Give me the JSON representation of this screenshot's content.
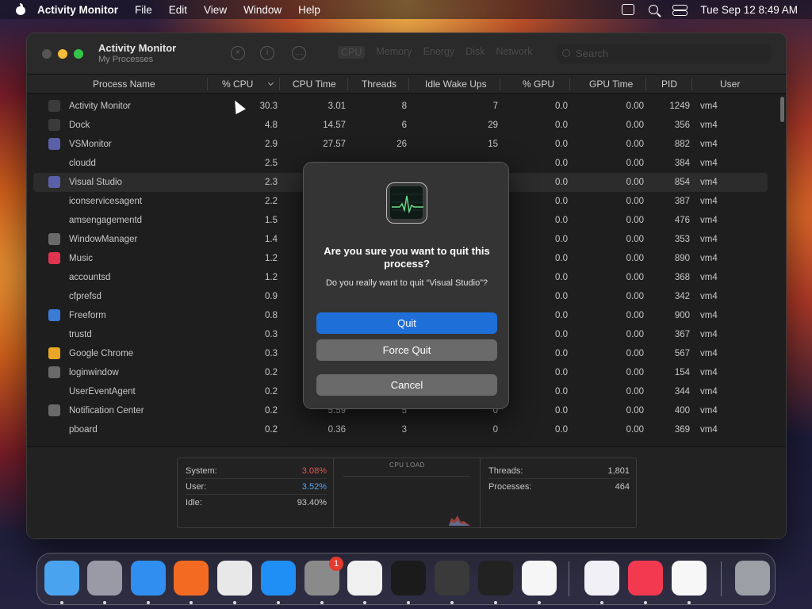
{
  "menubar": {
    "app_name": "Activity Monitor",
    "items": [
      "File",
      "Edit",
      "View",
      "Window",
      "Help"
    ],
    "datetime": "Tue Sep 12  8:49 AM"
  },
  "window": {
    "title": "Activity Monitor",
    "subtitle": "My Processes",
    "tabs": [
      "CPU",
      "Memory",
      "Energy",
      "Disk",
      "Network"
    ],
    "search_placeholder": "Search"
  },
  "table": {
    "columns": [
      "Process Name",
      "% CPU",
      "CPU Time",
      "Threads",
      "Idle Wake Ups",
      "% GPU",
      "GPU Time",
      "PID",
      "User"
    ],
    "rows": [
      {
        "name": "Activity Monitor",
        "cpu": "30.3",
        "cpu_time": "3.01",
        "threads": "8",
        "idle": "7",
        "gpu": "0.0",
        "gpu_time": "0.00",
        "pid": "1249",
        "user": "vm4",
        "icon": "activity-monitor-icon",
        "icon_color": "#3b3b3b"
      },
      {
        "name": "Dock",
        "cpu": "4.8",
        "cpu_time": "14.57",
        "threads": "6",
        "idle": "29",
        "gpu": "0.0",
        "gpu_time": "0.00",
        "pid": "356",
        "user": "vm4",
        "icon": "dock-icon",
        "icon_color": "#3b3b3b"
      },
      {
        "name": "VSMonitor",
        "cpu": "2.9",
        "cpu_time": "27.57",
        "threads": "26",
        "idle": "15",
        "gpu": "0.0",
        "gpu_time": "0.00",
        "pid": "882",
        "user": "vm4",
        "icon": "visual-studio-icon",
        "icon_color": "#5b5fa8"
      },
      {
        "name": "cloudd",
        "cpu": "2.5",
        "cpu_time": "",
        "threads": "",
        "idle": "",
        "gpu": "0.0",
        "gpu_time": "0.00",
        "pid": "384",
        "user": "vm4",
        "icon": "",
        "icon_color": ""
      },
      {
        "name": "Visual Studio",
        "cpu": "2.3",
        "cpu_time": "",
        "threads": "",
        "idle": "",
        "gpu": "0.0",
        "gpu_time": "0.00",
        "pid": "854",
        "user": "vm4",
        "icon": "visual-studio-icon",
        "icon_color": "#5b5fa8"
      },
      {
        "name": "iconservicesagent",
        "cpu": "2.2",
        "cpu_time": "",
        "threads": "",
        "idle": "",
        "gpu": "0.0",
        "gpu_time": "0.00",
        "pid": "387",
        "user": "vm4",
        "icon": "",
        "icon_color": ""
      },
      {
        "name": "amsengagementd",
        "cpu": "1.5",
        "cpu_time": "",
        "threads": "",
        "idle": "",
        "gpu": "0.0",
        "gpu_time": "0.00",
        "pid": "476",
        "user": "vm4",
        "icon": "",
        "icon_color": ""
      },
      {
        "name": "WindowManager",
        "cpu": "1.4",
        "cpu_time": "",
        "threads": "",
        "idle": "",
        "gpu": "0.0",
        "gpu_time": "0.00",
        "pid": "353",
        "user": "vm4",
        "icon": "window-manager-icon",
        "icon_color": "#6a6a6a"
      },
      {
        "name": "Music",
        "cpu": "1.2",
        "cpu_time": "",
        "threads": "",
        "idle": "",
        "gpu": "0.0",
        "gpu_time": "0.00",
        "pid": "890",
        "user": "vm4",
        "icon": "music-icon",
        "icon_color": "#e0344f"
      },
      {
        "name": "accountsd",
        "cpu": "1.2",
        "cpu_time": "",
        "threads": "",
        "idle": "",
        "gpu": "0.0",
        "gpu_time": "0.00",
        "pid": "368",
        "user": "vm4",
        "icon": "",
        "icon_color": ""
      },
      {
        "name": "cfprefsd",
        "cpu": "0.9",
        "cpu_time": "",
        "threads": "",
        "idle": "",
        "gpu": "0.0",
        "gpu_time": "0.00",
        "pid": "342",
        "user": "vm4",
        "icon": "",
        "icon_color": ""
      },
      {
        "name": "Freeform",
        "cpu": "0.8",
        "cpu_time": "",
        "threads": "",
        "idle": "",
        "gpu": "0.0",
        "gpu_time": "0.00",
        "pid": "900",
        "user": "vm4",
        "icon": "freeform-icon",
        "icon_color": "#3a7bd5"
      },
      {
        "name": "trustd",
        "cpu": "0.3",
        "cpu_time": "",
        "threads": "",
        "idle": "",
        "gpu": "0.0",
        "gpu_time": "0.00",
        "pid": "367",
        "user": "vm4",
        "icon": "",
        "icon_color": ""
      },
      {
        "name": "Google Chrome",
        "cpu": "0.3",
        "cpu_time": "",
        "threads": "",
        "idle": "",
        "gpu": "0.0",
        "gpu_time": "0.00",
        "pid": "567",
        "user": "vm4",
        "icon": "chrome-icon",
        "icon_color": "#e8a825"
      },
      {
        "name": "loginwindow",
        "cpu": "0.2",
        "cpu_time": "",
        "threads": "",
        "idle": "",
        "gpu": "0.0",
        "gpu_time": "0.00",
        "pid": "154",
        "user": "vm4",
        "icon": "loginwindow-icon",
        "icon_color": "#6a6a6a"
      },
      {
        "name": "UserEventAgent",
        "cpu": "0.2",
        "cpu_time": "",
        "threads": "",
        "idle": "",
        "gpu": "0.0",
        "gpu_time": "0.00",
        "pid": "344",
        "user": "vm4",
        "icon": "",
        "icon_color": ""
      },
      {
        "name": "Notification Center",
        "cpu": "0.2",
        "cpu_time": "5.59",
        "threads": "5",
        "idle": "0",
        "gpu": "0.0",
        "gpu_time": "0.00",
        "pid": "400",
        "user": "vm4",
        "icon": "notification-center-icon",
        "icon_color": "#6a6a6a"
      },
      {
        "name": "pboard",
        "cpu": "0.2",
        "cpu_time": "0.36",
        "threads": "3",
        "idle": "0",
        "gpu": "0.0",
        "gpu_time": "0.00",
        "pid": "369",
        "user": "vm4",
        "icon": "",
        "icon_color": ""
      }
    ]
  },
  "stats": {
    "system_label": "System:",
    "system_value": "3.08%",
    "user_label": "User:",
    "user_value": "3.52%",
    "idle_label": "Idle:",
    "idle_value": "93.40%",
    "cpu_load_label": "CPU LOAD",
    "threads_label": "Threads:",
    "threads_value": "1,801",
    "processes_label": "Processes:",
    "processes_value": "464",
    "system_color": "#e2564e",
    "user_color": "#5aa2e8"
  },
  "dialog": {
    "title": "Are you sure you want to quit this process?",
    "message": "Do you really want to quit “Visual Studio”?",
    "quit_label": "Quit",
    "force_quit_label": "Force Quit",
    "cancel_label": "Cancel"
  },
  "dock": {
    "items": [
      {
        "name": "finder-icon",
        "color": "#4aa3ef"
      },
      {
        "name": "launchpad-icon",
        "color": "#9a9aa6"
      },
      {
        "name": "safari-icon",
        "color": "#2f8ef0"
      },
      {
        "name": "firefox-icon",
        "color": "#f36b22"
      },
      {
        "name": "chrome-icon",
        "color": "#e8e8e8"
      },
      {
        "name": "app-store-icon",
        "color": "#1f8ef5"
      },
      {
        "name": "system-settings-icon",
        "color": "#8a8a8a"
      },
      {
        "name": "textedit-icon",
        "color": "#f0f0f0"
      },
      {
        "name": "terminal-icon",
        "color": "#1b1b1b"
      },
      {
        "name": "garageband-icon",
        "color": "#3a3a3a"
      },
      {
        "name": "activity-monitor-icon",
        "color": "#222"
      },
      {
        "name": "vscode-icon",
        "color": "#f6f6f6"
      },
      {
        "name": "visual-studio-icon",
        "color": "#f2f0f7"
      },
      {
        "name": "music-icon",
        "color": "#f2394f"
      },
      {
        "name": "freeform-icon",
        "color": "#f7f7f7"
      },
      {
        "name": "trash-icon",
        "color": "#9aa0a6"
      }
    ],
    "settings_badge": "1"
  }
}
